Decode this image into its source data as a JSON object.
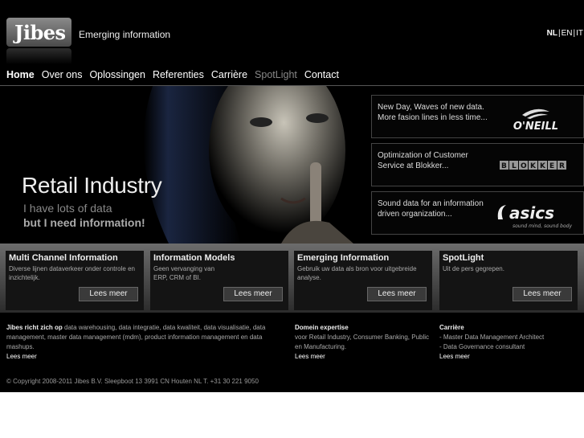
{
  "header": {
    "logo_text": "Jibes",
    "tagline": "Emerging information",
    "languages": [
      "NL",
      "EN",
      "IT"
    ],
    "active_language": "NL"
  },
  "nav": {
    "items": [
      "Home",
      "Over ons",
      "Oplossingen",
      "Referenties",
      "Carrière",
      "SpotLight",
      "Contact"
    ],
    "active": "Home"
  },
  "hero": {
    "title": "Retail Industry",
    "line1": "I have lots of data",
    "line2": "but I need information!"
  },
  "promos": [
    {
      "text": "New Day, Waves of new data. More fasion lines in less time...",
      "logo": "O'NEILL"
    },
    {
      "text": "Optimization of Customer Service at Blokker...",
      "logo": "BLOKKER"
    },
    {
      "text": "Sound data for an information driven organization...",
      "logo": "asics",
      "logo_tagline": "sound mind, sound body"
    }
  ],
  "boxes": [
    {
      "title": "Multi Channel Information",
      "desc": "Diverse lijnen dataverkeer onder controle en inzichtelijk.",
      "button": "Lees meer"
    },
    {
      "title": "Information Models",
      "desc": "Geen vervanging van ERP, CRM of BI.",
      "button": "Lees meer"
    },
    {
      "title": "Emerging Information",
      "desc": "Gebruik uw data als bron voor uitgebreide analyse.",
      "button": "Lees meer"
    },
    {
      "title": "SpotLight",
      "desc": "Uit de pers gegrepen.",
      "button": "Lees meer"
    }
  ],
  "footer": {
    "col1_bold": "Jibes richt zich op",
    "col1_text": " data warehousing, data integratie, data kwaliteit, data visualisatie, data management, master data management (mdm), product information management en data mashups.",
    "col1_link": "Lees meer",
    "col2_title": "Domein expertise",
    "col2_text": "voor Retail Industry, Consumer Banking, Public en Manufacturing.",
    "col2_link": "Lees meer",
    "col3_title": "Carrière",
    "col3_item1": "- Master Data Management Architect",
    "col3_item2": "- Data Governance consultant",
    "col3_link": "Lees meer",
    "copyright": "© Copyright 2008-2011 Jibes B.V. Sleepboot 13 3991 CN Houten NL T. +31 30 221 9050"
  },
  "colors": {
    "background": "#000000",
    "nav_inactive": "#888888"
  }
}
